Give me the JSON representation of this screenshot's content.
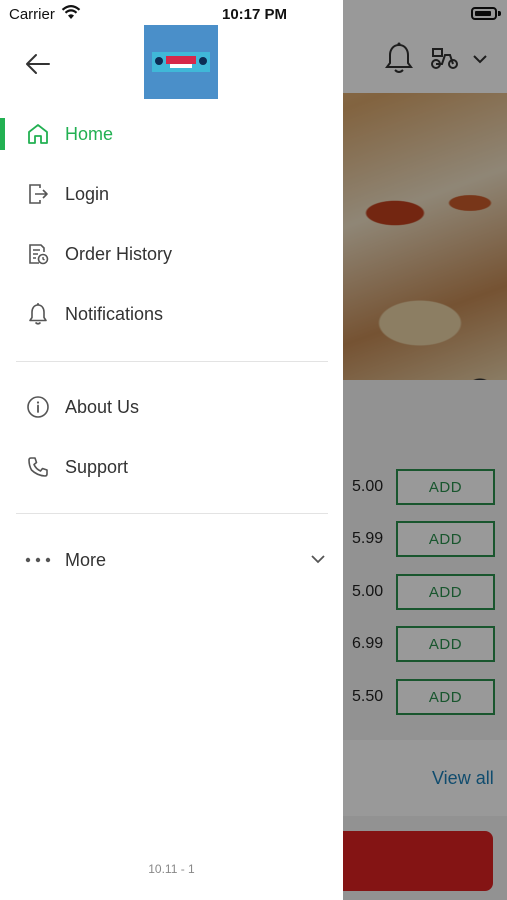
{
  "status_bar": {
    "carrier": "Carrier",
    "time": "10:17 PM"
  },
  "background": {
    "rows": [
      {
        "price": "5.00",
        "button": "ADD"
      },
      {
        "price": "5.99",
        "button": "ADD"
      },
      {
        "price": "5.00",
        "button": "ADD"
      },
      {
        "price": "6.99",
        "button": "ADD"
      },
      {
        "price": "5.50",
        "button": "ADD"
      }
    ],
    "view_all": "View all"
  },
  "drawer": {
    "menu": [
      {
        "label": "Home",
        "icon": "home-icon",
        "active": true
      },
      {
        "label": "Login",
        "icon": "login-icon",
        "active": false
      },
      {
        "label": "Order History",
        "icon": "order-history-icon",
        "active": false
      },
      {
        "label": "Notifications",
        "icon": "bell-icon",
        "active": false
      }
    ],
    "secondary": [
      {
        "label": "About Us",
        "icon": "info-icon"
      },
      {
        "label": "Support",
        "icon": "phone-icon"
      }
    ],
    "more": {
      "label": "More",
      "icon": "more-dots-icon"
    },
    "version": "10.11 - 1"
  },
  "colors": {
    "accent": "#22b052",
    "icon": "#555555",
    "text": "#333333",
    "add_button": "#2a8f4e",
    "link": "#1c7fb7"
  }
}
